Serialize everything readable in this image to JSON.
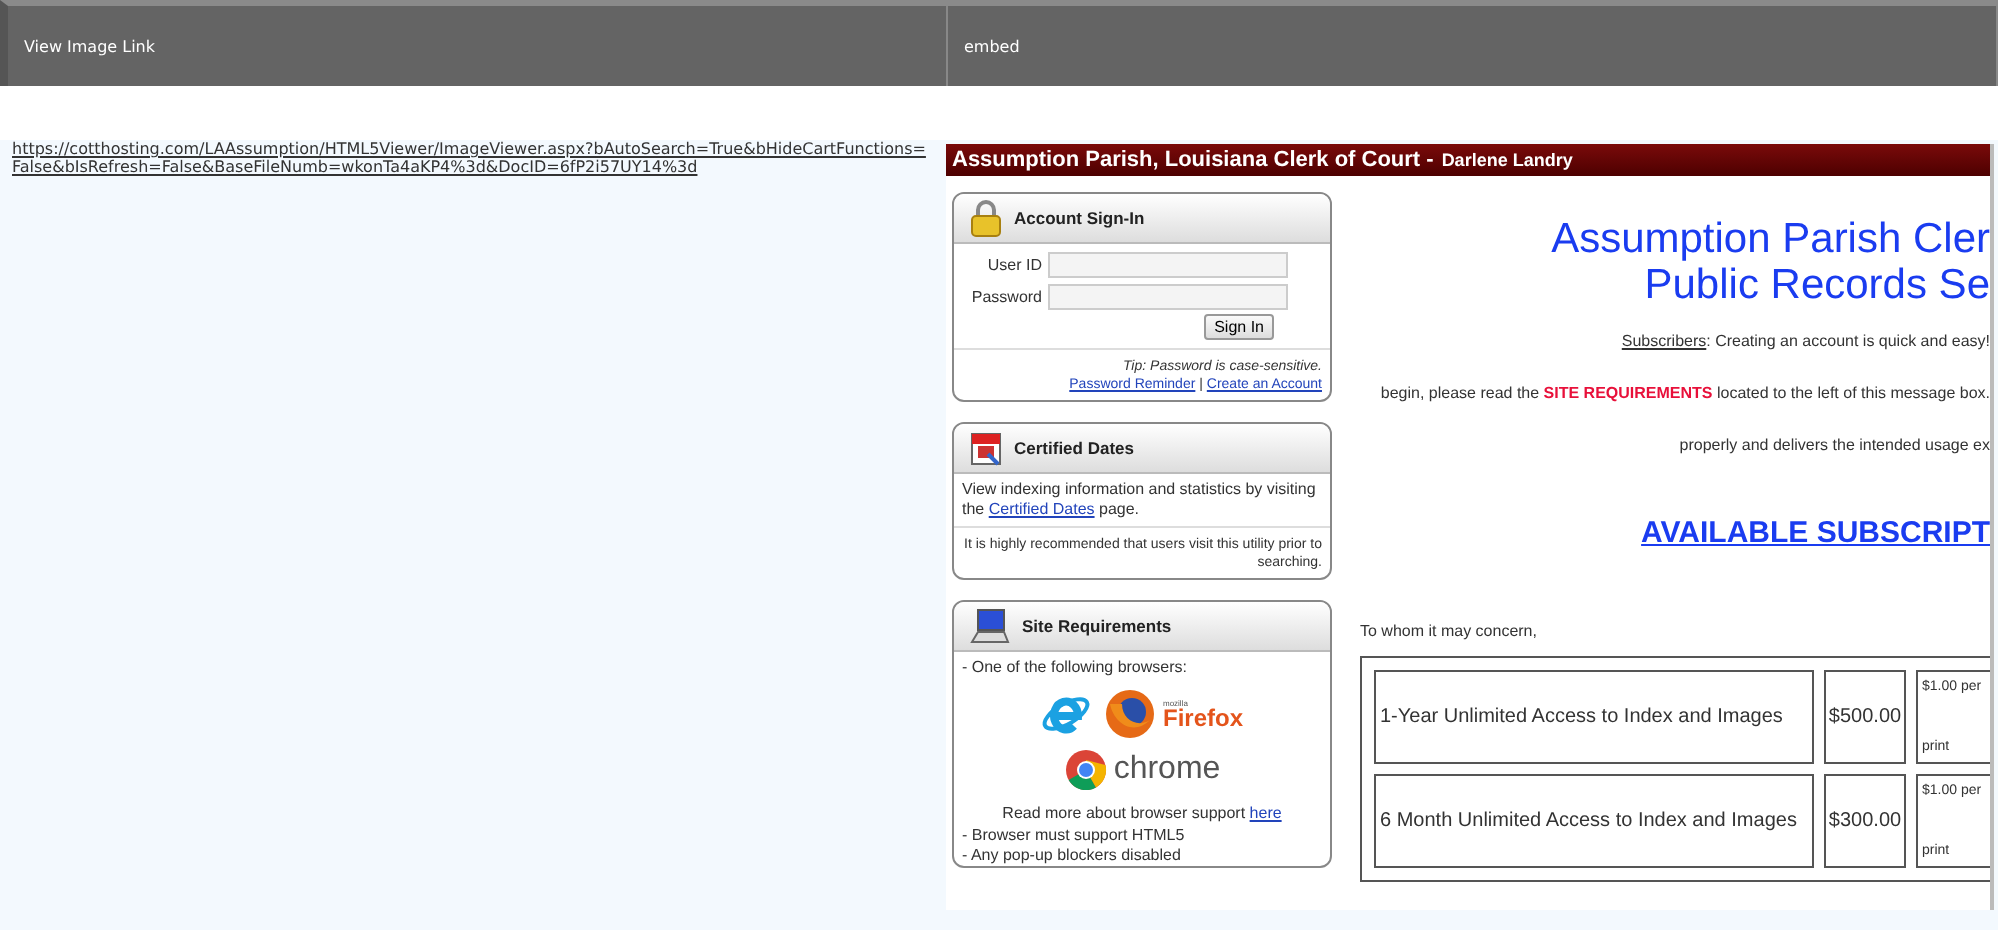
{
  "table": {
    "columns": [
      "View Image Link",
      "embed"
    ],
    "rows": [
      {
        "link": "https://cotthosting.com/LAAssumption/HTML5Viewer/ImageViewer.aspx?bAutoSearch=True&bHideCartFunctions=False&bIsRefresh=False&BaseFileNumb=wkonTa4aKP4%3d&DocID=6fP2i57UY14%3d",
        "embed": {
          "banner": {
            "title": "Assumption Parish, Louisiana Clerk of Court -",
            "clerk": "Darlene Landry"
          },
          "sign_in": {
            "title": "Account Sign-In",
            "fields": [
              {
                "label": "User ID"
              },
              {
                "label": "Password"
              }
            ],
            "button": "Sign In",
            "tip": "Tip: Password is case-sensitive.",
            "links": [
              "Password Reminder",
              "Create an Account"
            ],
            "separator": "|"
          },
          "certified_dates": {
            "title": "Certified Dates",
            "text_before": "View indexing information and statistics by visiting the",
            "link": "Certified Dates",
            "text_after": "page.",
            "note": "It is highly recommended that users visit this utility prior to searching."
          },
          "site_requirements": {
            "title": "Site Requirements",
            "intro": "- One of the following browsers:",
            "browsers": [
              {
                "kind": "ie"
              },
              {
                "kind": "firefox",
                "maker": "mozilla",
                "label": "Firefox"
              },
              {
                "kind": "chrome",
                "label": "chrome"
              }
            ],
            "support_text": "Read more about browser support",
            "support_link": "here",
            "items": [
              "- Browser must support HTML5",
              "- Any pop-up blockers disabled"
            ]
          },
          "heading": [
            "Assumption Parish Cler",
            "Public Records Se"
          ],
          "subscribers_label": "Subscribers",
          "subscribers_text": ":  Creating an account is quick and easy!",
          "line2_before": "begin, please read the",
          "line2_highlight": "SITE REQUIREMENTS",
          "line2_after": "located to the left of this message box.",
          "line3": "properly and delivers the intended usage ex",
          "subscriptions_link": "AVAILABLE SUBSCRIPT",
          "salutation": "To whom it may concern,",
          "plans": [
            {
              "name": "1-Year Unlimited Access to Index and Images",
              "price": "$500.00",
              "fee": [
                "$1.00 per",
                "print"
              ]
            },
            {
              "name": "6 Month Unlimited Access to Index and Images",
              "price": "$300.00",
              "fee": [
                "$1.00 per",
                "print"
              ]
            }
          ]
        }
      }
    ]
  }
}
